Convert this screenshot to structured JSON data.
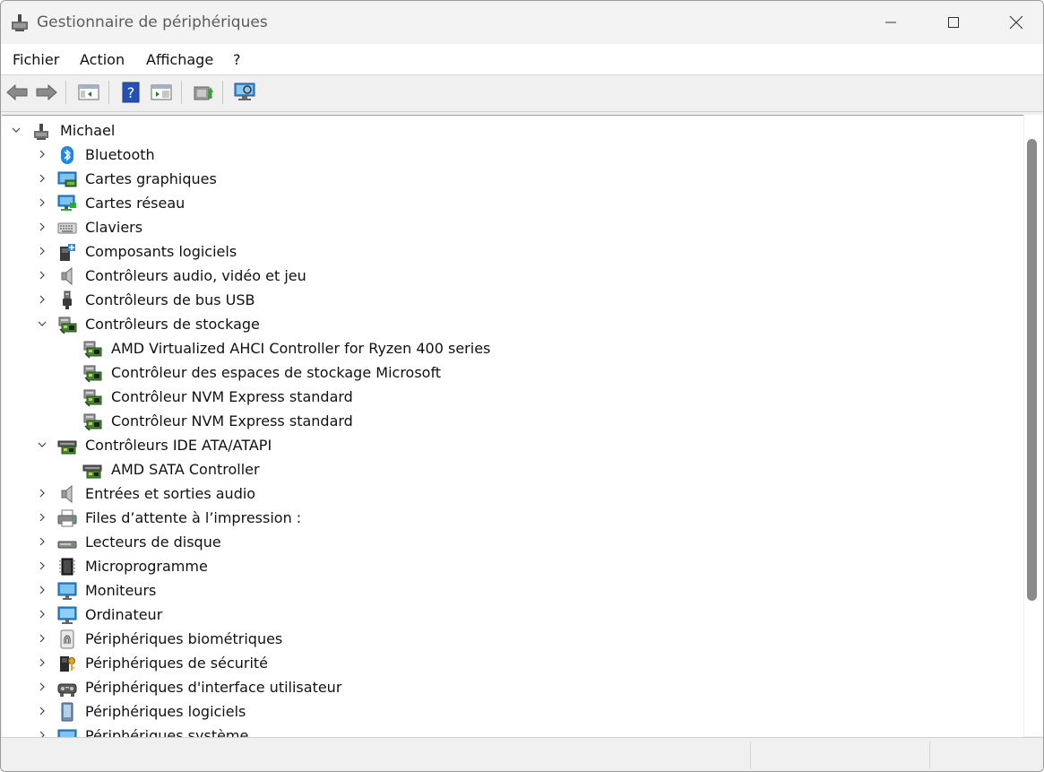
{
  "window": {
    "title": "Gestionnaire de périphériques"
  },
  "menu": [
    "Fichier",
    "Action",
    "Affichage",
    "?"
  ],
  "toolbar_icons": [
    "back-arrow-icon",
    "forward-arrow-icon",
    "show-hide-console-tree-icon",
    "help-icon",
    "properties-view-icon",
    "update-driver-icon",
    "scan-hardware-icon"
  ],
  "tree": {
    "root": {
      "label": "Michael",
      "icon": "computer-network-icon",
      "expanded": true
    },
    "items": [
      {
        "label": "Bluetooth",
        "icon": "bluetooth-icon",
        "expanded": false,
        "level": 1
      },
      {
        "label": "Cartes graphiques",
        "icon": "display-adapter-icon",
        "expanded": false,
        "level": 1
      },
      {
        "label": "Cartes réseau",
        "icon": "network-adapter-icon",
        "expanded": false,
        "level": 1
      },
      {
        "label": "Claviers",
        "icon": "keyboard-icon",
        "expanded": false,
        "level": 1
      },
      {
        "label": "Composants logiciels",
        "icon": "software-component-icon",
        "expanded": false,
        "level": 1
      },
      {
        "label": "Contrôleurs audio, vidéo et jeu",
        "icon": "speaker-icon",
        "expanded": false,
        "level": 1
      },
      {
        "label": "Contrôleurs de bus USB",
        "icon": "usb-icon",
        "expanded": false,
        "level": 1
      },
      {
        "label": "Contrôleurs de stockage",
        "icon": "storage-controller-icon",
        "expanded": true,
        "level": 1
      },
      {
        "label": "AMD Virtualized AHCI Controller for Ryzen 400 series",
        "icon": "storage-controller-icon",
        "level": 2
      },
      {
        "label": "Contrôleur des espaces de stockage Microsoft",
        "icon": "storage-controller-icon",
        "level": 2
      },
      {
        "label": "Contrôleur NVM Express standard",
        "icon": "storage-controller-icon",
        "level": 2
      },
      {
        "label": "Contrôleur NVM Express standard",
        "icon": "storage-controller-icon",
        "level": 2
      },
      {
        "label": "Contrôleurs IDE ATA/ATAPI",
        "icon": "ide-controller-icon",
        "expanded": true,
        "level": 1
      },
      {
        "label": "AMD SATA Controller",
        "icon": "ide-controller-icon",
        "level": 2
      },
      {
        "label": "Entrées et sorties audio",
        "icon": "speaker-icon",
        "expanded": false,
        "level": 1
      },
      {
        "label": "Files d’attente à l’impression :",
        "icon": "printer-icon",
        "expanded": false,
        "level": 1
      },
      {
        "label": "Lecteurs de disque",
        "icon": "disk-drive-icon",
        "expanded": false,
        "level": 1
      },
      {
        "label": "Microprogramme",
        "icon": "firmware-chip-icon",
        "expanded": false,
        "level": 1
      },
      {
        "label": "Moniteurs",
        "icon": "monitor-icon",
        "expanded": false,
        "level": 1
      },
      {
        "label": "Ordinateur",
        "icon": "computer-icon",
        "expanded": false,
        "level": 1
      },
      {
        "label": "Périphériques biométriques",
        "icon": "fingerprint-icon",
        "expanded": false,
        "level": 1
      },
      {
        "label": "Périphériques de sécurité",
        "icon": "security-key-icon",
        "expanded": false,
        "level": 1
      },
      {
        "label": "Périphériques d'interface utilisateur",
        "icon": "hid-icon",
        "expanded": false,
        "level": 1
      },
      {
        "label": "Périphériques logiciels",
        "icon": "software-device-icon",
        "expanded": false,
        "level": 1
      },
      {
        "label": "Périphériques système",
        "icon": "system-device-icon",
        "expanded": false,
        "level": 1
      }
    ]
  },
  "colors": {
    "selection_accent": "#0067c0",
    "bluetooth": "#1e88e5",
    "scrollbar_thumb": "#8a8a8a"
  }
}
